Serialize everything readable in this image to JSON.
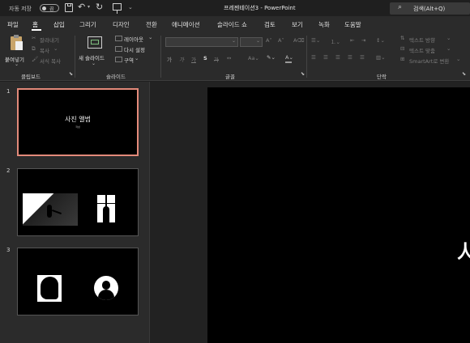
{
  "titlebar": {
    "autosave_label": "자동 저장",
    "autosave_state": "끔",
    "doc_title": "프레젠테이션3 - PowerPoint",
    "search_placeholder": "검색(Alt+Q)"
  },
  "menu": {
    "tabs": [
      "파일",
      "홈",
      "삽입",
      "그리기",
      "디자인",
      "전환",
      "애니메이션",
      "슬라이드 쇼",
      "검토",
      "보기",
      "녹화",
      "도움말"
    ],
    "active": "홈"
  },
  "ribbon": {
    "clipboard": {
      "paste": "붙여넣기",
      "cut": "잘라내기",
      "copy": "복사",
      "format_painter": "서식 복사",
      "group": "클립보드"
    },
    "slides": {
      "new_slide": "새 슬라이드",
      "layout": "레이아웃",
      "reset": "다시 설정",
      "section": "구역",
      "group": "슬라이드"
    },
    "font": {
      "group": "글꼴",
      "bold": "가",
      "italic": "가",
      "underline": "가",
      "strike": "가",
      "shadow": "S"
    },
    "paragraph": {
      "group": "단락",
      "text_direction": "텍스트 방향",
      "align_text": "텍스트 맞춤",
      "smartart": "SmartArt로 변환"
    }
  },
  "slides_panel": {
    "slides": [
      {
        "number": "1",
        "title": "사진 앨범",
        "subtitle": "작성"
      },
      {
        "number": "2"
      },
      {
        "number": "3"
      }
    ]
  },
  "editor": {
    "visible_text": "시"
  }
}
